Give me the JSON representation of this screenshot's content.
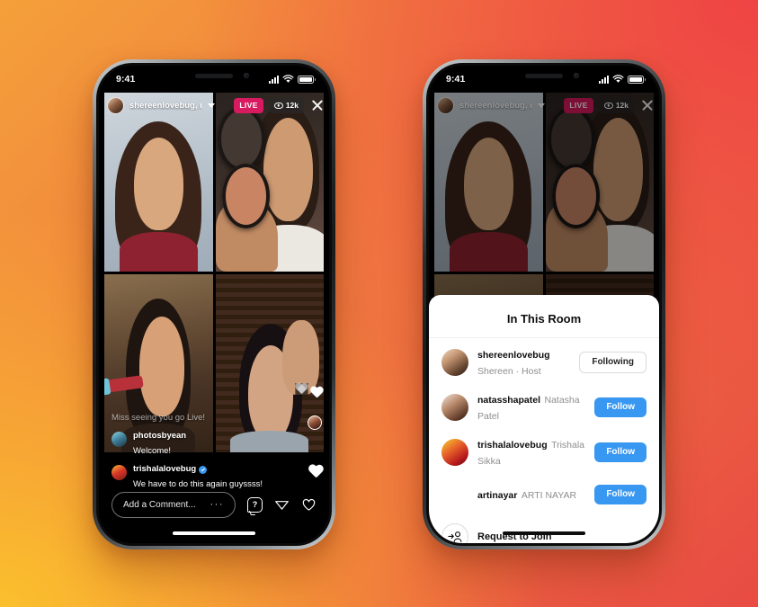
{
  "background": {
    "gradient_from": "#fbc02d",
    "gradient_mid": "#f07840",
    "gradient_to": "#e84b43"
  },
  "phones": {
    "left": {
      "status_bar": {
        "time": "9:41",
        "signal_icon": "cellular-signal-icon",
        "wifi_icon": "wifi-icon",
        "battery_icon": "battery-icon"
      },
      "live_header": {
        "host_avatar": "host-avatar",
        "host_names": "shereenlovebug, n...",
        "chevron_icon": "chevron-down-icon",
        "live_label": "LIVE",
        "viewer_icon": "eye-icon",
        "viewer_count": "12k",
        "close_icon": "close-icon"
      },
      "participants": [
        {
          "name": "participant-top-left"
        },
        {
          "name": "participant-top-right"
        },
        {
          "name": "participant-bottom-left"
        },
        {
          "name": "participant-bottom-right"
        }
      ],
      "comments": [
        {
          "username": "",
          "text": "Miss seeing you go Live!",
          "verified": false,
          "faded": true
        },
        {
          "username": "photosbyean",
          "text": "Welcome!",
          "verified": false,
          "faded": false
        },
        {
          "username": "trishalalovebug",
          "text": "We have to do this again guyssss!",
          "verified": true,
          "faded": false
        }
      ],
      "bottom_bar": {
        "comment_placeholder": "Add a Comment...",
        "more_icon": "ellipsis-icon",
        "question_icon": "question-bubble-icon",
        "share_icon": "paper-plane-icon",
        "like_icon": "heart-icon"
      },
      "reactions": {
        "heart_icon": "floating-heart-icon",
        "mini_avatar": "reaction-avatar"
      }
    },
    "right": {
      "status_bar": {
        "time": "9:41",
        "signal_icon": "cellular-signal-icon",
        "wifi_icon": "wifi-icon",
        "battery_icon": "battery-icon"
      },
      "live_header": {
        "host_avatar": "host-avatar",
        "host_names": "shereenlovebug, n...",
        "chevron_icon": "chevron-down-icon",
        "live_label": "LIVE",
        "viewer_icon": "eye-icon",
        "viewer_count": "12k",
        "close_icon": "close-icon"
      },
      "sheet": {
        "handle": "sheet-drag-handle",
        "title": "In This Room",
        "members": [
          {
            "username": "shereenlovebug",
            "fullname": "Shereen · Host",
            "action": "Following",
            "action_style": "following"
          },
          {
            "username": "natasshapatel",
            "fullname": "Natasha Patel",
            "action": "Follow",
            "action_style": "follow"
          },
          {
            "username": "trishalalovebug",
            "fullname": "Trishala Sikka",
            "action": "Follow",
            "action_style": "follow"
          },
          {
            "username": "artinayar",
            "fullname": "ARTI NAYAR",
            "action": "Follow",
            "action_style": "follow"
          }
        ],
        "request": {
          "icon": "add-person-icon",
          "label": "Request to Join"
        }
      }
    }
  },
  "colors": {
    "instagram_blue": "#3897f0",
    "live_pink": "#d81b60",
    "sheet_white": "#ffffff",
    "secondary_text": "#8e8e8e"
  }
}
